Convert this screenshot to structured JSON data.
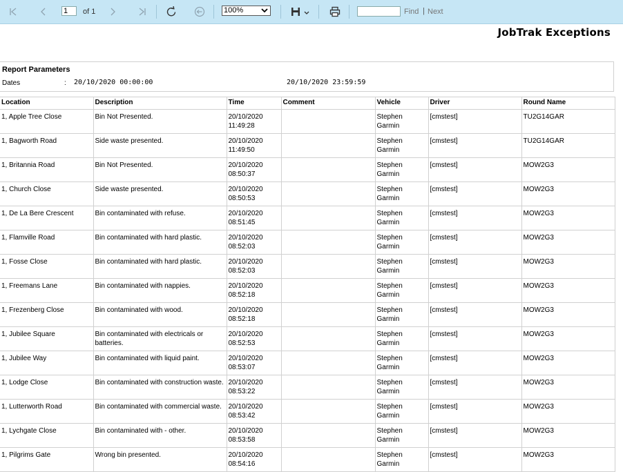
{
  "toolbar": {
    "page_value": "1",
    "page_of": "of 1",
    "zoom": "100%",
    "find_label": "Find",
    "separator": "|",
    "next_label": "Next"
  },
  "report": {
    "title": "JobTrak Exceptions",
    "params": {
      "heading": "Report Parameters",
      "label": "Dates",
      "colon": ":",
      "from": "20/10/2020 00:00:00",
      "to": "20/10/2020 23:59:59"
    },
    "columns": [
      "Location",
      "Description",
      "Time",
      "Comment",
      "Vehicle",
      "Driver",
      "Round Name"
    ],
    "rows": [
      {
        "location": "1, Apple Tree Close",
        "description": "Bin Not Presented.",
        "date": "20/10/2020",
        "time": "11:49:28",
        "comment": "",
        "vehicle": "Stephen Garmin",
        "driver": "[cmstest]",
        "round": "TU2G14GAR"
      },
      {
        "location": "1, Bagworth Road",
        "description": "Side waste presented.",
        "date": "20/10/2020",
        "time": "11:49:50",
        "comment": "",
        "vehicle": "Stephen Garmin",
        "driver": "[cmstest]",
        "round": "TU2G14GAR"
      },
      {
        "location": "1, Britannia Road",
        "description": "Bin Not Presented.",
        "date": "20/10/2020",
        "time": "08:50:37",
        "comment": "",
        "vehicle": "Stephen Garmin",
        "driver": "[cmstest]",
        "round": "MOW2G3"
      },
      {
        "location": "1, Church Close",
        "description": "Side waste presented.",
        "date": "20/10/2020",
        "time": "08:50:53",
        "comment": "",
        "vehicle": "Stephen Garmin",
        "driver": "[cmstest]",
        "round": "MOW2G3"
      },
      {
        "location": "1, De La Bere Crescent",
        "description": "Bin contaminated with refuse.",
        "date": "20/10/2020",
        "time": "08:51:45",
        "comment": "",
        "vehicle": "Stephen Garmin",
        "driver": "[cmstest]",
        "round": "MOW2G3"
      },
      {
        "location": "1, Flamville Road",
        "description": "Bin contaminated with hard plastic.",
        "date": "20/10/2020",
        "time": "08:52:03",
        "comment": "",
        "vehicle": "Stephen Garmin",
        "driver": "[cmstest]",
        "round": "MOW2G3"
      },
      {
        "location": "1, Fosse Close",
        "description": "Bin contaminated with hard plastic.",
        "date": "20/10/2020",
        "time": "08:52:03",
        "comment": "",
        "vehicle": "Stephen Garmin",
        "driver": "[cmstest]",
        "round": "MOW2G3"
      },
      {
        "location": "1, Freemans Lane",
        "description": "Bin contaminated with nappies.",
        "date": "20/10/2020",
        "time": "08:52:18",
        "comment": "",
        "vehicle": "Stephen Garmin",
        "driver": "[cmstest]",
        "round": "MOW2G3"
      },
      {
        "location": "1, Frezenberg Close",
        "description": "Bin contaminated with wood.",
        "date": "20/10/2020",
        "time": "08:52:18",
        "comment": "",
        "vehicle": "Stephen Garmin",
        "driver": "[cmstest]",
        "round": "MOW2G3"
      },
      {
        "location": "1, Jubilee Square",
        "description": "Bin contaminated with electricals or batteries.",
        "date": "20/10/2020",
        "time": "08:52:53",
        "comment": "",
        "vehicle": "Stephen Garmin",
        "driver": "[cmstest]",
        "round": "MOW2G3"
      },
      {
        "location": "1, Jubilee Way",
        "description": "Bin contaminated with liquid paint.",
        "date": "20/10/2020",
        "time": "08:53:07",
        "comment": "",
        "vehicle": "Stephen Garmin",
        "driver": "[cmstest]",
        "round": "MOW2G3"
      },
      {
        "location": "1, Lodge Close",
        "description": "Bin contaminated with construction waste.",
        "date": "20/10/2020",
        "time": "08:53:22",
        "comment": "",
        "vehicle": "Stephen Garmin",
        "driver": "[cmstest]",
        "round": "MOW2G3"
      },
      {
        "location": "1, Lutterworth Road",
        "description": "Bin contaminated with commercial waste.",
        "date": "20/10/2020",
        "time": "08:53:42",
        "comment": "",
        "vehicle": "Stephen Garmin",
        "driver": "[cmstest]",
        "round": "MOW2G3"
      },
      {
        "location": "1, Lychgate Close",
        "description": "Bin contaminated with - other.",
        "date": "20/10/2020",
        "time": "08:53:58",
        "comment": "",
        "vehicle": "Stephen Garmin",
        "driver": "[cmstest]",
        "round": "MOW2G3"
      },
      {
        "location": "1, Pilgrims Gate",
        "description": "Wrong bin presented.",
        "date": "20/10/2020",
        "time": "08:54:16",
        "comment": "",
        "vehicle": "Stephen Garmin",
        "driver": "[cmstest]",
        "round": "MOW2G3"
      }
    ]
  }
}
